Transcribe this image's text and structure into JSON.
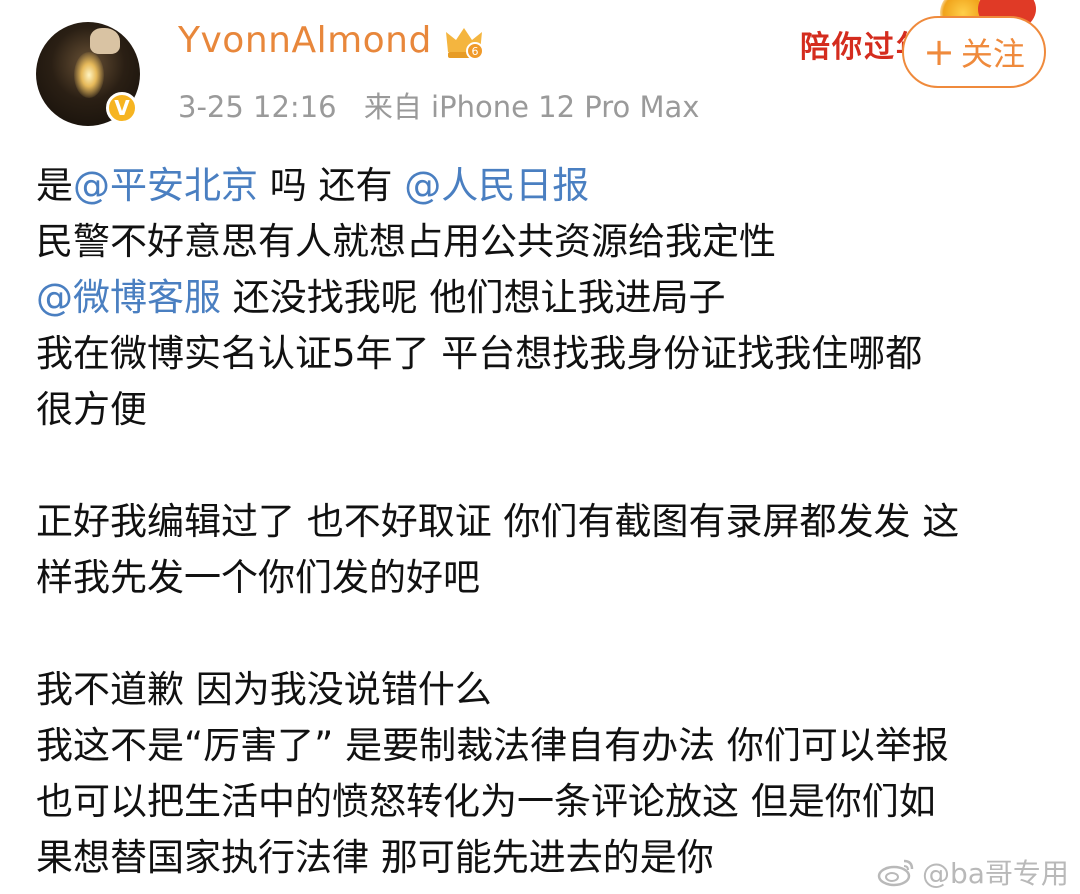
{
  "post": {
    "username": "YvonnAlmond",
    "date": "3-25 12:16",
    "source": "来自 iPhone 12 Pro Max",
    "vip_level": "6",
    "verified_mark": "V"
  },
  "promo_banner": {
    "text": "陪你过年"
  },
  "follow_button": {
    "plus": "+",
    "label": "关注"
  },
  "content": {
    "line1": {
      "a": "是",
      "m1": "@平安北京",
      "b": " 吗 还有 ",
      "m2": "@人民日报"
    },
    "line2": "民警不好意思有人就想占用公共资源给我定性",
    "line3": {
      "m1": "@微博客服",
      "b": " 还没找我呢 他们想让我进局子"
    },
    "line4": "我在微博实名认证5年了 平台想找我身份证找我住哪都",
    "line5": "很方便",
    "line6": "正好我编辑过了 也不好取证 你们有截图有录屏都发发 这",
    "line7": "样我先发一个你们发的好吧",
    "line8": "我不道歉 因为我没说错什么",
    "line9": "我这不是“厉害了” 是要制裁法律自有办法 你们可以举报",
    "line10": "也可以把生活中的愤怒转化为一条评论放这 但是你们如",
    "line11": "果想替国家执行法律 那可能先进去的是你"
  },
  "watermark": {
    "text": "@ba哥专用"
  },
  "colors": {
    "username": "#e8873b",
    "mention": "#4a7fc1",
    "meta": "#9a9a9a",
    "follow_accent": "#ef8a3c",
    "promo_red": "#d42c1e"
  }
}
